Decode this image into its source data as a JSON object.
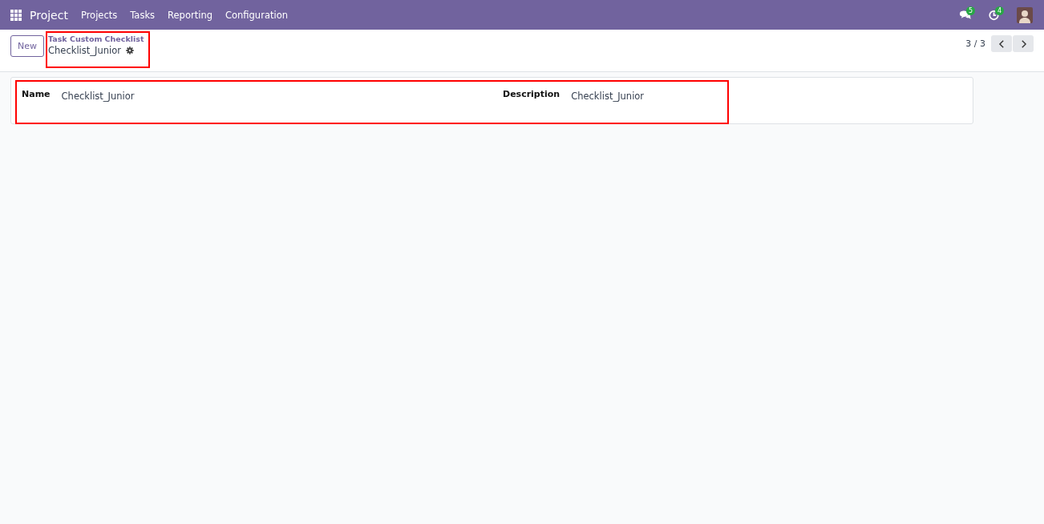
{
  "navbar": {
    "app": "Project",
    "menu": [
      "Projects",
      "Tasks",
      "Reporting",
      "Configuration"
    ],
    "messages_count": "5",
    "activities_count": "4"
  },
  "control_panel": {
    "new_button": "New",
    "breadcrumb": {
      "parent": "Task Custom Checklist",
      "current": "Checklist_Junior",
      "highlighted": true
    },
    "pager": "3 / 3"
  },
  "form": {
    "highlighted": true,
    "fields": [
      {
        "label": "Name",
        "value": "Checklist_Junior"
      },
      {
        "label": "Description",
        "value": "Checklist_Junior"
      }
    ]
  }
}
